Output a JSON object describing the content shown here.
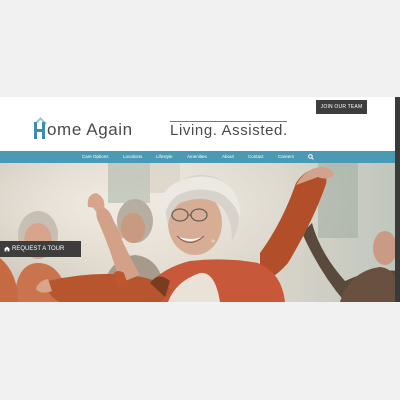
{
  "header": {
    "join_label": "JOIN OUR TEAM",
    "logo_text": "ome Again",
    "tagline": "Living. Assisted."
  },
  "nav": {
    "items": [
      {
        "label": "Care Options"
      },
      {
        "label": "Locations"
      },
      {
        "label": "Lifestyle"
      },
      {
        "label": "Amenities"
      },
      {
        "label": "About"
      },
      {
        "label": "Contact"
      },
      {
        "label": "Careers"
      }
    ],
    "search_icon": "search-icon"
  },
  "hero": {
    "tour_label": "REQUEST A TOUR",
    "tour_icon": "building-icon"
  },
  "colors": {
    "brand_teal": "#4a9ab5",
    "dark_button": "#3d3d3d"
  }
}
